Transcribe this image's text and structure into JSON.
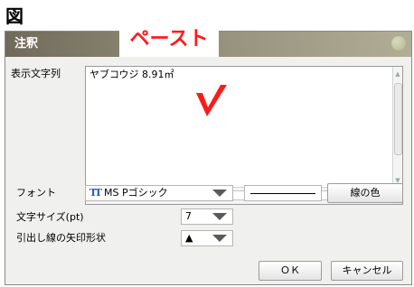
{
  "figure": {
    "label": "図"
  },
  "dialog": {
    "title": "注釈",
    "callout": "ペースト",
    "text_label": "表示文字列",
    "text_value": "ヤブコウジ 8.91㎡",
    "font_label": "フォント",
    "font_value": "MS Pゴシック",
    "font_icon": "truetype-font-icon",
    "line_color_button": "線の色",
    "size_label": "文字サイズ(pt)",
    "size_value": "7",
    "arrow_label": "引出し線の矢印形状",
    "arrow_value": "▲",
    "ok_button": "ＯＫ",
    "cancel_button": "キャンセル"
  },
  "colors": {
    "callout": "#ff1a1a",
    "title_text": "#ffffff",
    "titlebar_dark": "#6f6a5b",
    "titlebar_light": "#b1ad97",
    "dialog_bg": "#f0f0ee"
  }
}
